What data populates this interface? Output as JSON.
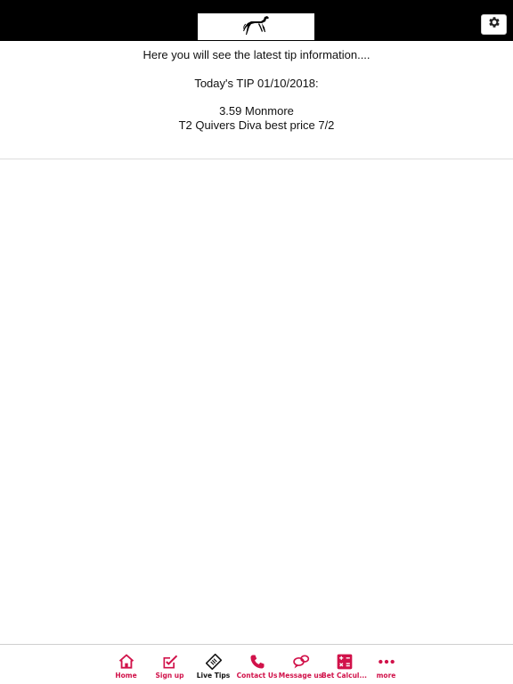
{
  "colors": {
    "header_bg": "#000000",
    "accent": "#d1124a",
    "active_nav": "#111111"
  },
  "header": {
    "logo_icon": "greyhound-logo-icon",
    "settings_icon": "gear-icon"
  },
  "content": {
    "intro": "Here you will see the latest tip information....",
    "tip_heading": "Today's TIP 01/10/2018:",
    "race": "3.59 Monmore",
    "selection": "T2 Quivers Diva best price 7/2"
  },
  "nav": {
    "active": "Live Tips",
    "items": [
      {
        "label": "Home",
        "icon": "home-icon"
      },
      {
        "label": "Sign up",
        "icon": "edit-check-icon"
      },
      {
        "label": "Live Tips",
        "icon": "ticket-icon"
      },
      {
        "label": "Contact Us",
        "icon": "phone-icon"
      },
      {
        "label": "Message us",
        "icon": "chat-icon"
      },
      {
        "label": "Bet Calcul...",
        "icon": "calculator-icon"
      },
      {
        "label": "more",
        "icon": "more-dots-icon"
      }
    ]
  }
}
